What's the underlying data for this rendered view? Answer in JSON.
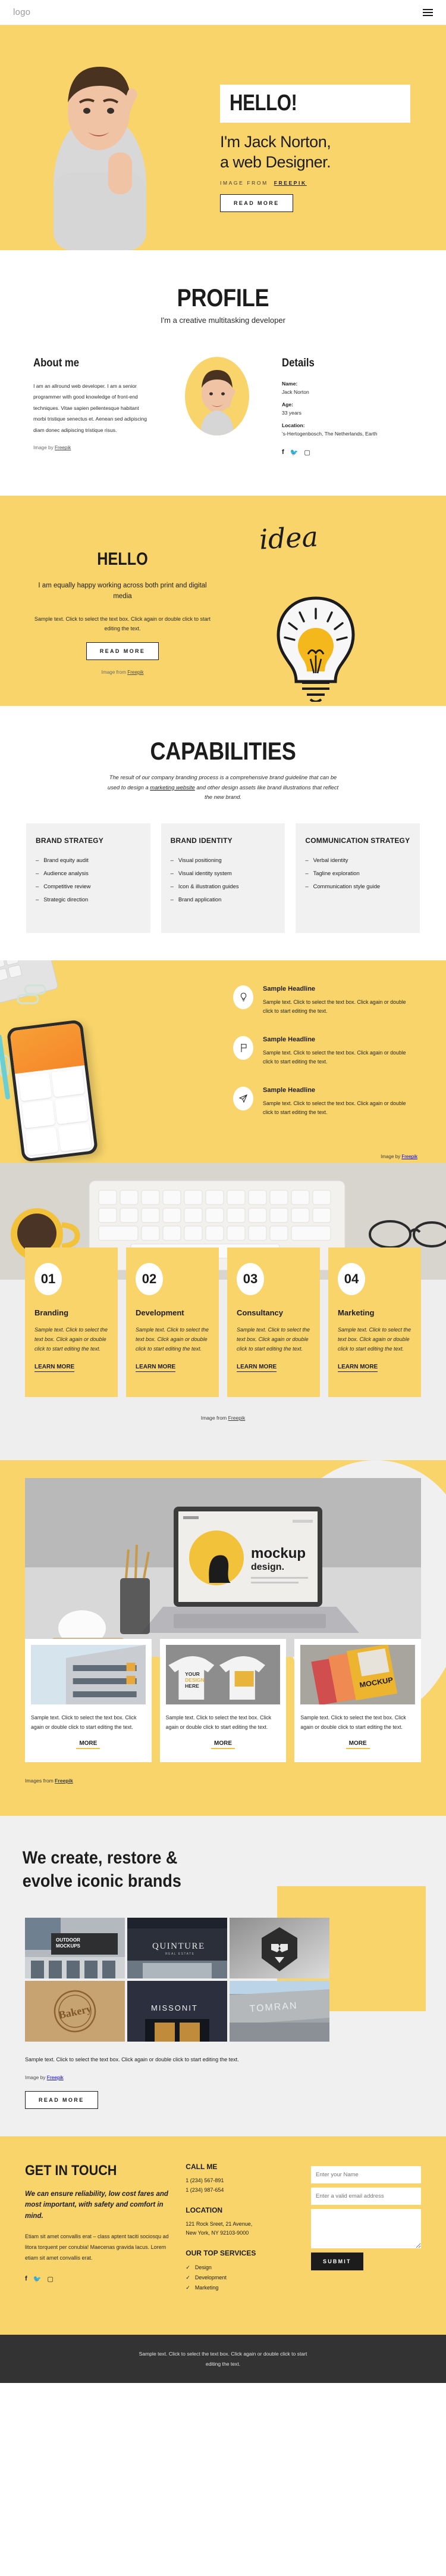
{
  "nav": {
    "logo": "logo",
    "menu_icon": "hamburger-menu-icon"
  },
  "hero": {
    "hello": "HELLO!",
    "line1": "I'm Jack Norton,",
    "line2": "a web Designer.",
    "credit_prefix": "IMAGE FROM",
    "credit_link": "FREEPIK",
    "cta": "READ MORE"
  },
  "profile": {
    "title": "PROFILE",
    "subtitle": "I'm a creative multitasking developer",
    "about_heading": "About me",
    "about_body": "I am an allround web developer. I am a senior programmer with good knowledge of front-end techniques. Vitae sapien pellentesque habitant morbi tristique senectus et. Aenean sed adipiscing diam donec adipiscing tristique risus.",
    "about_credit_prefix": "Image by",
    "about_credit_link": "Freepik",
    "details_heading": "Details",
    "fields": [
      {
        "key": "Name:",
        "value": "Jack Norton"
      },
      {
        "key": "Age:",
        "value": "33 years"
      },
      {
        "key": "Location:",
        "value": "'s-Hertogenbosch, The Netherlands, Earth"
      }
    ],
    "socials": [
      "facebook-icon",
      "twitter-icon",
      "instagram-icon"
    ]
  },
  "idea": {
    "heading": "HELLO",
    "lead": "I am equally happy working across both print and digital media",
    "body": "Sample text. Click to select the text box. Click again or double click to start editing the text.",
    "cta": "READ MORE",
    "credit_prefix": "Image from",
    "credit_link": "Freepik",
    "word": "idea",
    "bulb_icon": "lightbulb-icon"
  },
  "capabilities": {
    "title": "CAPABILITIES",
    "lead_a": "The result of our company branding process is a comprehensive brand guideline that can be used to design a ",
    "lead_link": "marketing website",
    "lead_b": " and other design assets like brand illustrations that reflect the new brand.",
    "cards": [
      {
        "title": "BRAND STRATEGY",
        "items": [
          "Brand equity audit",
          "Audience analysis",
          "Competitive review",
          "Strategic direction"
        ]
      },
      {
        "title": "BRAND IDENTITY",
        "items": [
          "Visual positioning",
          "Visual identity system",
          "Icon & illustration guides",
          "Brand application"
        ]
      },
      {
        "title": "COMMUNICATION STRATEGY",
        "items": [
          "Verbal identity",
          "Tagline exploration",
          "Communication style guide"
        ]
      }
    ]
  },
  "features": {
    "items": [
      {
        "icon": "lightbulb-outline-icon",
        "title": "Sample Headline",
        "body": "Sample text. Click to select the text box. Click again or double click to start editing the text."
      },
      {
        "icon": "flag-outline-icon",
        "title": "Sample Headline",
        "body": "Sample text. Click to select the text box. Click again or double click to start editing the text."
      },
      {
        "icon": "paper-plane-outline-icon",
        "title": "Sample Headline",
        "body": "Sample text. Click to select the text box. Click again or double click to start editing the text."
      }
    ],
    "credit_prefix": "Image by",
    "credit_link": "Freepik"
  },
  "services": {
    "cards": [
      {
        "num": "01",
        "title": "Branding",
        "body": "Sample text. Click to select the text box. Click again or double click to start editing the text.",
        "cta": "LEARN MORE"
      },
      {
        "num": "02",
        "title": "Development",
        "body": "Sample text. Click to select the text box. Click again or double click to start editing the text.",
        "cta": "LEARN MORE"
      },
      {
        "num": "03",
        "title": "Consultancy",
        "body": "Sample text. Click to select the text box. Click again or double click to start editing the text.",
        "cta": "LEARN MORE"
      },
      {
        "num": "04",
        "title": "Marketing",
        "body": "Sample text. Click to select the text box. Click again or double click to start editing the text.",
        "cta": "LEARN MORE"
      }
    ],
    "credit_prefix": "Image from",
    "credit_link": "Freepik"
  },
  "mockups": {
    "laptop_text": "mockup design.",
    "cards": [
      {
        "thumb": "building-facade-photo",
        "body": "Sample text. Click to select the text box. Click again or double click to start editing the text.",
        "cta": "MORE"
      },
      {
        "thumb": "sweater-mockup-photo",
        "body": "Sample text. Click to select the text box. Click again or double click to start editing the text.",
        "cta": "MORE"
      },
      {
        "thumb": "flyer-mockup-photo",
        "body": "Sample text. Click to select the text box. Click again or double click to start editing the text.",
        "cta": "MORE"
      }
    ],
    "credit_prefix": "Images from",
    "credit_link": "Freepik"
  },
  "brands": {
    "heading_line1": "We create, restore &",
    "heading_line2": "evolve iconic brands",
    "tiles": [
      {
        "label": "OUTDOOR MOCKUPS"
      },
      {
        "label": "QUINTURE"
      },
      {
        "label": "lion-logo-sign"
      },
      {
        "label": "Bakery"
      },
      {
        "label": "MISSONIT"
      },
      {
        "label": "TOMRAN"
      }
    ],
    "body": "Sample text. Click to select the text box. Click again or double click to start editing the text.",
    "credit_prefix": "Image by",
    "credit_link": "Freepik",
    "cta": "READ MORE"
  },
  "contact": {
    "title": "GET IN TOUCH",
    "strong": "We can ensure reliability, low cost fares and most important, with safety and comfort in mind.",
    "body": "Etiam sit amet convallis erat – class aptent taciti sociosqu ad litora torquent per conubia! Maecenas gravida lacus. Lorem etiam sit amet convallis erat.",
    "socials": [
      "facebook-icon",
      "twitter-icon",
      "instagram-icon"
    ],
    "call_heading": "CALL ME",
    "phone1": "1 (234) 567-891",
    "phone2": "1 (234) 987-654",
    "location_heading": "LOCATION",
    "address1": "121 Rock Sreet, 21 Avenue,",
    "address2": "New York, NY 92103-9000",
    "services_heading": "OUR TOP SERVICES",
    "services": [
      "Design",
      "Development",
      "Marketing"
    ],
    "form": {
      "name_placeholder": "Enter your Name",
      "email_placeholder": "Enter a valid email address",
      "message_placeholder": "",
      "submit": "SUBMIT"
    }
  },
  "footer": {
    "text": "Sample text. Click to select the text box. Click again or double click to start editing the text."
  },
  "colors": {
    "accent": "#f8d46a",
    "dark": "#1c1c1c",
    "footer": "#333333",
    "light": "#f0f0f0"
  }
}
